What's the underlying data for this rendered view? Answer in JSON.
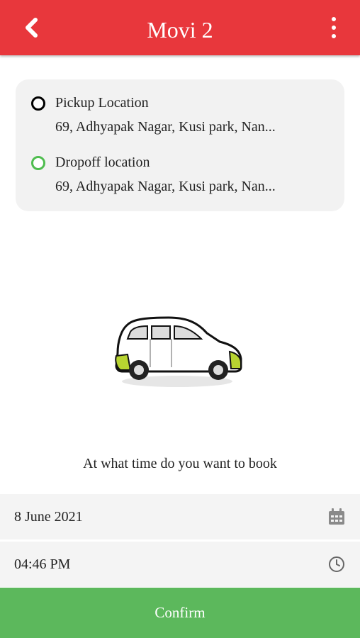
{
  "header": {
    "title": "Movi 2",
    "back_icon": "chevron-left-icon",
    "menu_icon": "more-vertical-icon",
    "color": "#e8373c"
  },
  "locations": {
    "pickup": {
      "label": "Pickup Location",
      "address": "69, Adhyapak Nagar, Kusi park, Nan..."
    },
    "dropoff": {
      "label": "Dropoff location",
      "address": "69, Adhyapak Nagar, Kusi park, Nan..."
    }
  },
  "booking": {
    "question": "At what time do you want to book",
    "date": "8 June 2021",
    "date_icon": "calendar-icon",
    "time": "04:46 PM",
    "time_icon": "clock-icon"
  },
  "confirm_label": "Confirm",
  "colors": {
    "accent": "#e8373c",
    "confirm": "#5cb85c",
    "dropoff_ring": "#4fbd4f"
  }
}
